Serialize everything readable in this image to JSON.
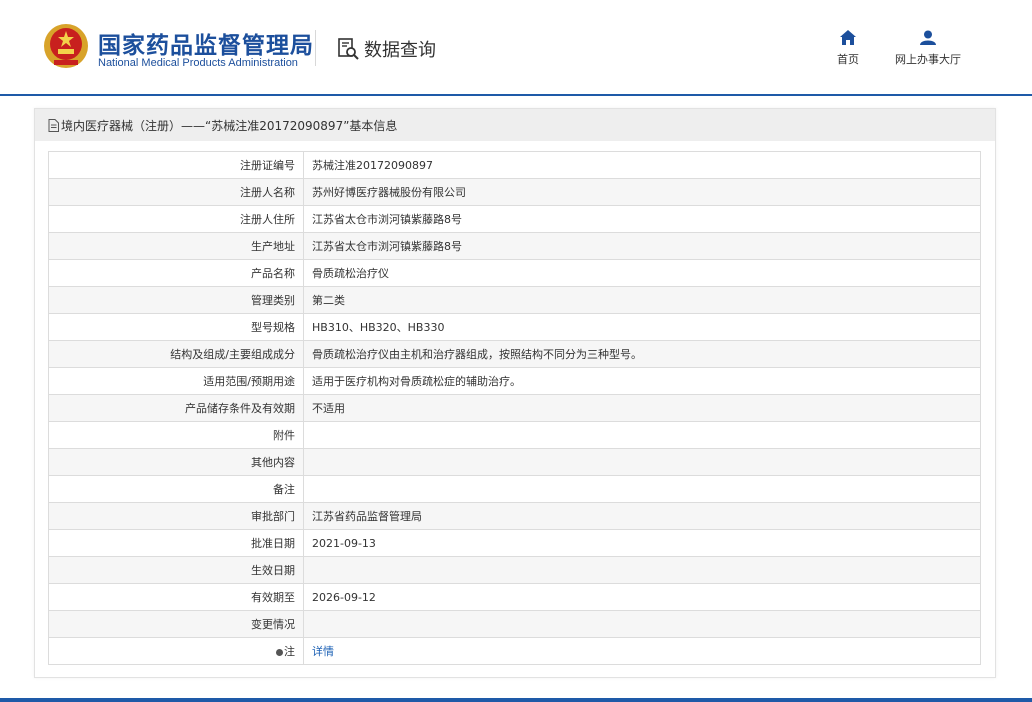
{
  "header": {
    "title_cn": "国家药品监督管理局",
    "title_en": "National Medical Products Administration",
    "query_label": "数据查询",
    "nav": [
      {
        "label": "首页",
        "icon": "home-icon"
      },
      {
        "label": "网上办事大厅",
        "icon": "user-icon"
      }
    ]
  },
  "panel": {
    "title": "境内医疗器械（注册）——“苏械注准20172090897”基本信息"
  },
  "rows": [
    {
      "label": "注册证编号",
      "value": "苏械注准20172090897"
    },
    {
      "label": "注册人名称",
      "value": "苏州好博医疗器械股份有限公司"
    },
    {
      "label": "注册人住所",
      "value": "江苏省太仓市浏河镇紫藤路8号"
    },
    {
      "label": "生产地址",
      "value": "江苏省太仓市浏河镇紫藤路8号"
    },
    {
      "label": "产品名称",
      "value": "骨质疏松治疗仪"
    },
    {
      "label": "管理类别",
      "value": "第二类"
    },
    {
      "label": "型号规格",
      "value": "HB310、HB320、HB330"
    },
    {
      "label": "结构及组成/主要组成成分",
      "value": "骨质疏松治疗仪由主机和治疗器组成，按照结构不同分为三种型号。"
    },
    {
      "label": "适用范围/预期用途",
      "value": "适用于医疗机构对骨质疏松症的辅助治疗。"
    },
    {
      "label": "产品储存条件及有效期",
      "value": "不适用"
    },
    {
      "label": "附件",
      "value": ""
    },
    {
      "label": "其他内容",
      "value": ""
    },
    {
      "label": "备注",
      "value": ""
    },
    {
      "label": "审批部门",
      "value": "江苏省药品监督管理局"
    },
    {
      "label": "批准日期",
      "value": "2021-09-13"
    },
    {
      "label": "生效日期",
      "value": ""
    },
    {
      "label": "有效期至",
      "value": "2026-09-12"
    },
    {
      "label": "变更情况",
      "value": ""
    }
  ],
  "note_row": {
    "label": "注",
    "link": "详情"
  },
  "colors": {
    "brand": "#1c4f9c",
    "accent_line": "#1e5aa8",
    "link": "#1a5fb4"
  }
}
